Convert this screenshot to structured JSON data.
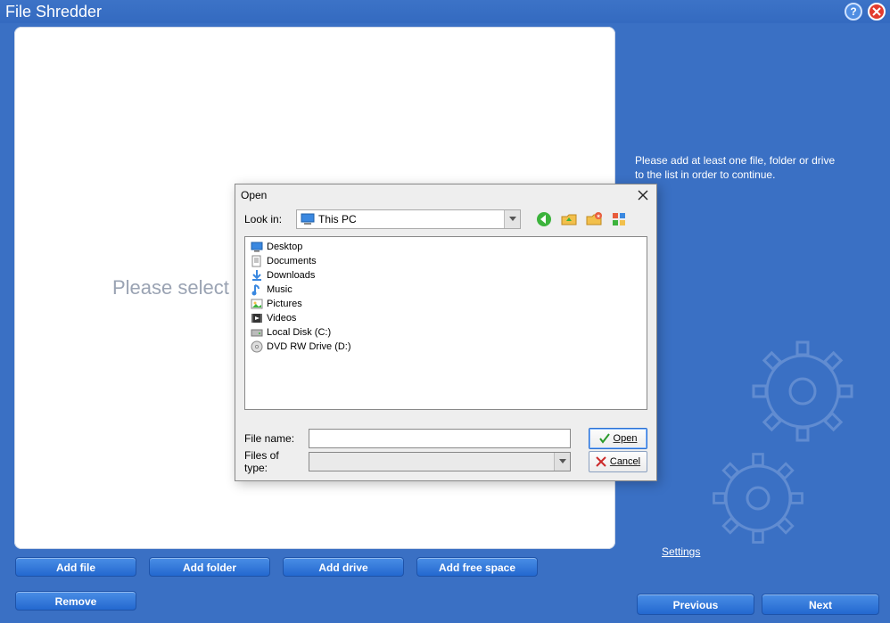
{
  "header": {
    "title": "File Shredder"
  },
  "panel": {
    "placeholder": "Please select"
  },
  "info": "Please add at least one file, folder or drive\nto the list in order to continue.",
  "buttons": {
    "add_file": "Add file",
    "add_folder": "Add folder",
    "add_drive": "Add drive",
    "add_free_space": "Add free space",
    "remove": "Remove",
    "settings": "Settings",
    "previous": "Previous",
    "next": "Next"
  },
  "dialog": {
    "title": "Open",
    "lookin_label": "Look in:",
    "lookin_value": "This PC",
    "items": [
      {
        "label": "Desktop",
        "icon": "desktop"
      },
      {
        "label": "Documents",
        "icon": "document"
      },
      {
        "label": "Downloads",
        "icon": "download"
      },
      {
        "label": "Music",
        "icon": "music"
      },
      {
        "label": "Pictures",
        "icon": "picture"
      },
      {
        "label": "Videos",
        "icon": "video"
      },
      {
        "label": "Local Disk (C:)",
        "icon": "disk"
      },
      {
        "label": "DVD RW Drive (D:)",
        "icon": "dvd"
      }
    ],
    "filename_label": "File name:",
    "filename_value": "",
    "filetype_label": "Files of type:",
    "filetype_value": "",
    "open_label": "Open",
    "cancel_label": "Cancel"
  }
}
